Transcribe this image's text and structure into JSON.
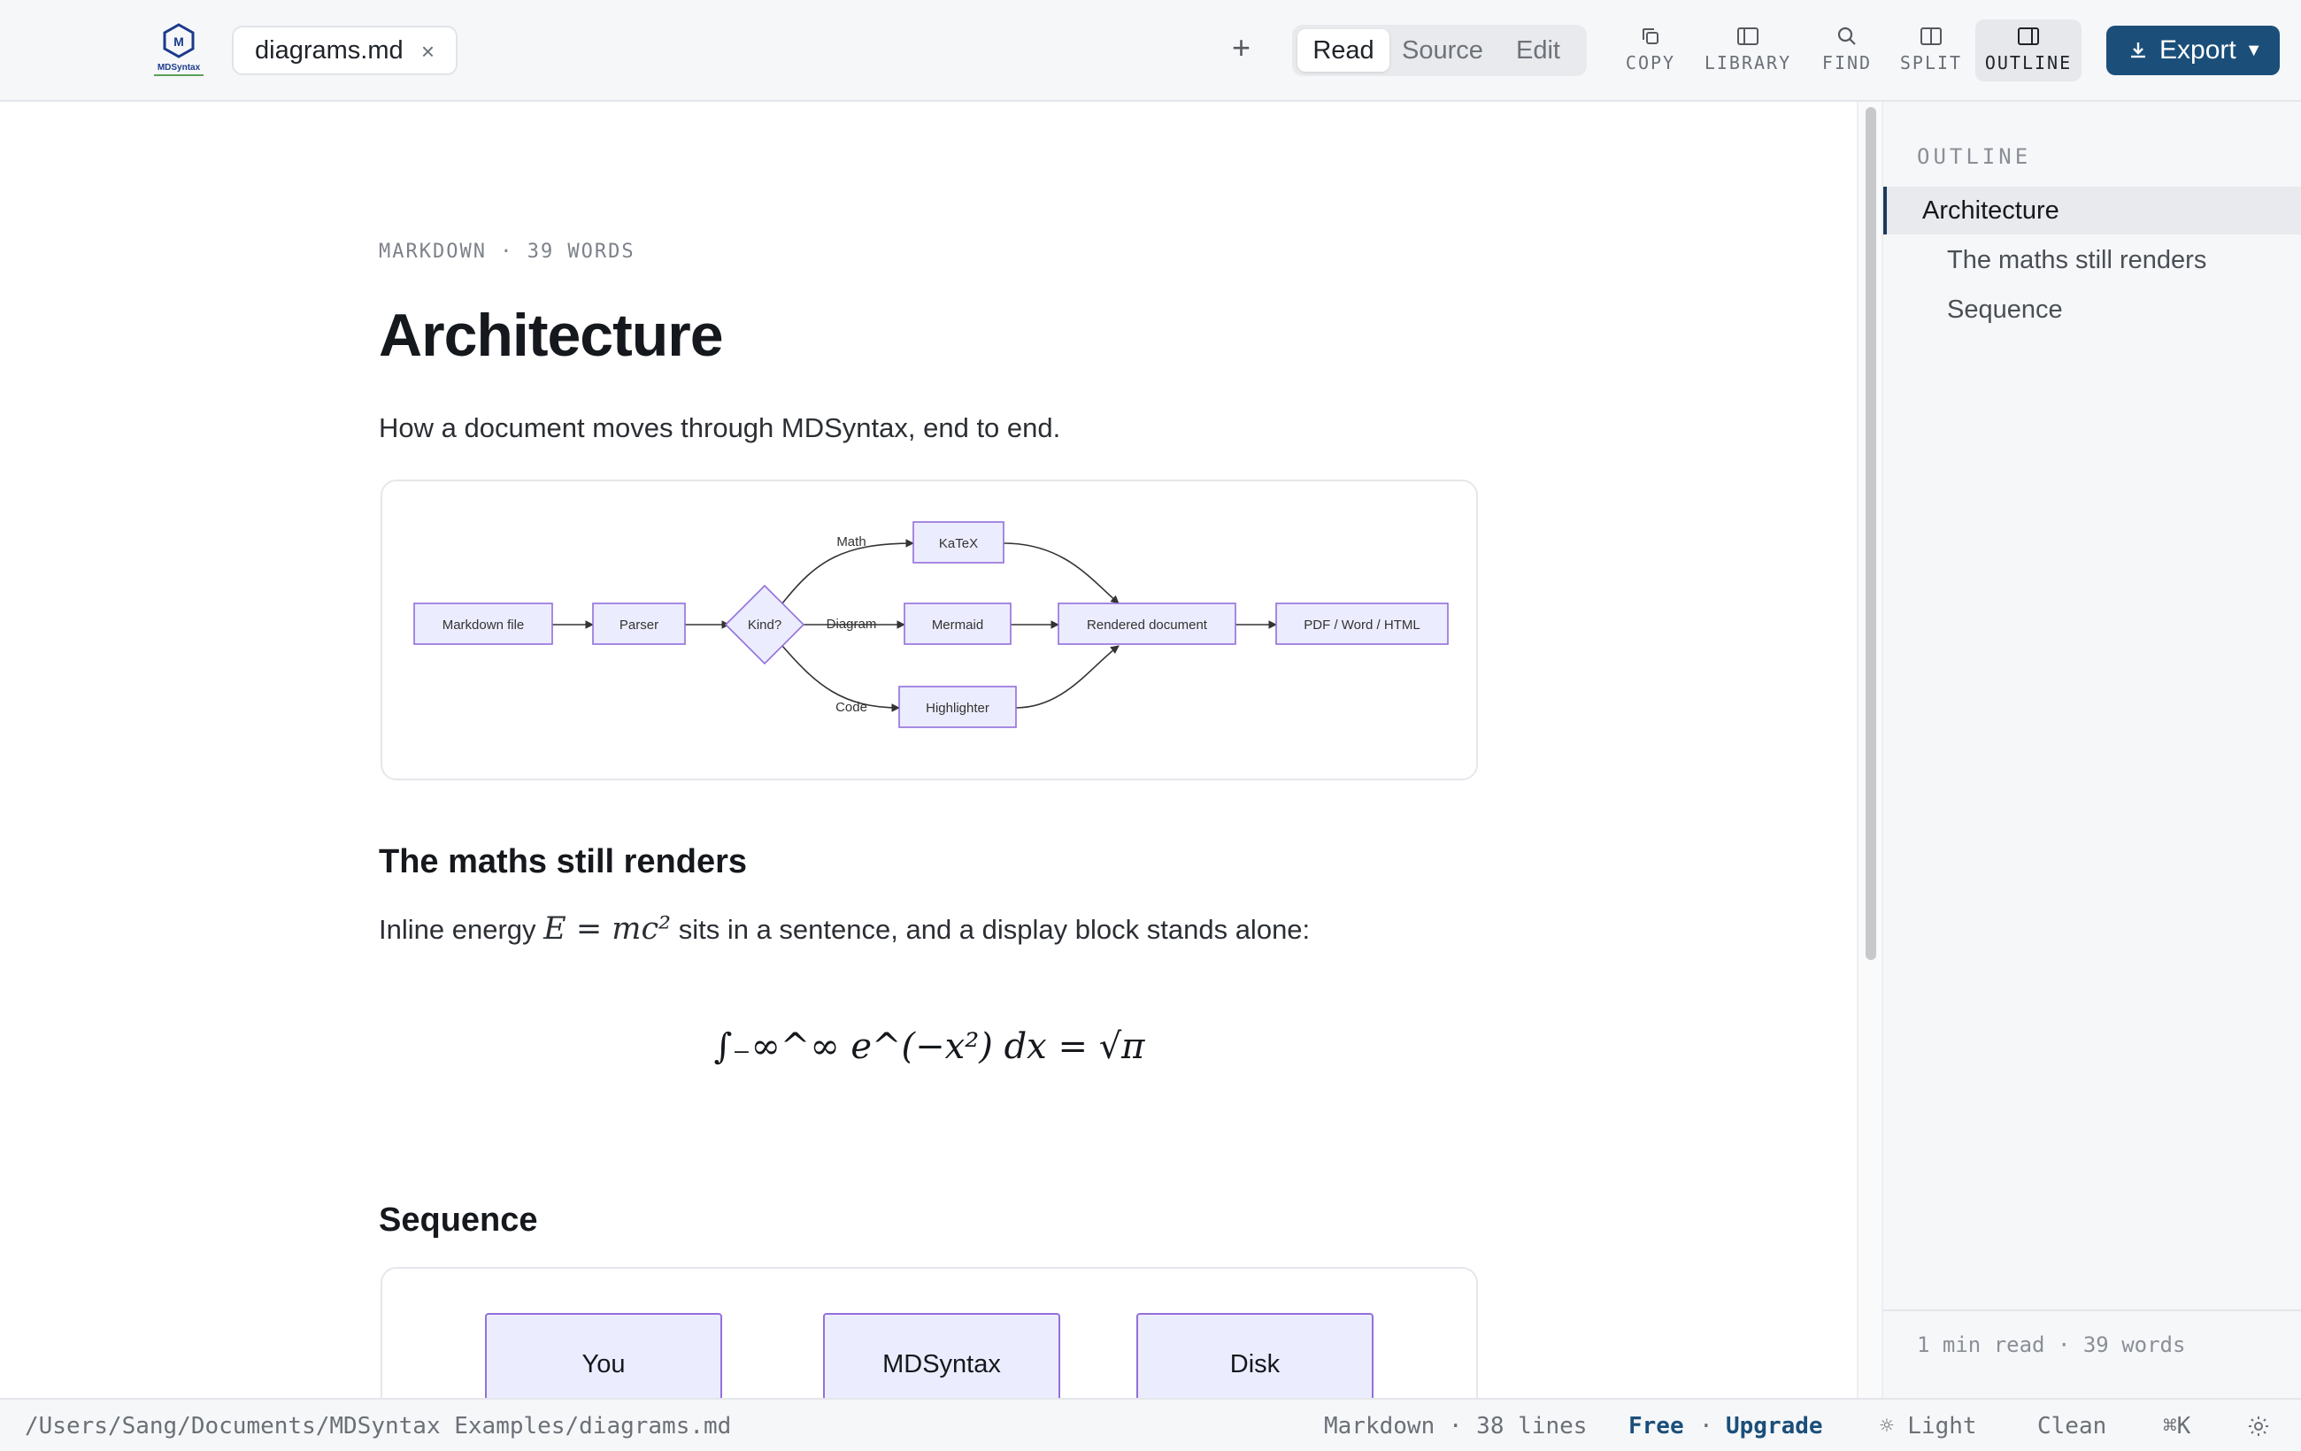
{
  "toolbar": {
    "logo_text": "MDSyntax",
    "tab": {
      "label": "diagrams.md",
      "close": "×"
    },
    "new_tab": "+",
    "view_modes": [
      "Read",
      "Source",
      "Edit"
    ],
    "active_view_mode": "Read",
    "tools": [
      {
        "label": "COPY",
        "icon": "copy-icon"
      },
      {
        "label": "LIBRARY",
        "icon": "library-icon"
      },
      {
        "label": "FIND",
        "icon": "search-icon"
      },
      {
        "label": "SPLIT",
        "icon": "split-icon"
      },
      {
        "label": "OUTLINE",
        "icon": "outline-icon",
        "active": true
      }
    ],
    "export": {
      "label": "Export",
      "icon": "download-icon"
    }
  },
  "document": {
    "meta": "MARKDOWN · 39 WORDS",
    "title": "Architecture",
    "lead": "How a document moves through MDSyntax, end to end.",
    "flowchart": {
      "nodes": {
        "markdown": "Markdown file",
        "parser": "Parser",
        "kind": "Kind?",
        "katex": "KaTeX",
        "mermaid": "Mermaid",
        "highlighter": "Highlighter",
        "rendered": "Rendered document",
        "output": "PDF / Word / HTML"
      },
      "edges": {
        "math": "Math",
        "diagram": "Diagram",
        "code": "Code"
      }
    },
    "section_math": {
      "heading": "The maths still renders",
      "text_before": "Inline energy",
      "inline_formula": "E = mc²",
      "text_after": "sits in a sentence, and a display block stands alone:",
      "display_formula": "∫₋∞^∞ e^(−x²) dx = √π"
    },
    "section_sequence": {
      "heading": "Sequence",
      "participants": [
        "You",
        "MDSyntax",
        "Disk"
      ]
    }
  },
  "outline": {
    "title": "OUTLINE",
    "items": [
      {
        "label": "Architecture",
        "level": 1,
        "active": true
      },
      {
        "label": "The maths still renders",
        "level": 2
      },
      {
        "label": "Sequence",
        "level": 2
      }
    ],
    "footer": "1 min read · 39 words"
  },
  "statusbar": {
    "path": "/Users/Sang/Documents/MDSyntax Examples/diagrams.md",
    "language": "Markdown · 38 lines",
    "plan": "Free",
    "separator": "·",
    "upgrade": "Upgrade",
    "theme": "☼ Light",
    "style": "Clean",
    "shortcut": "⌘K",
    "settings_icon": "sun-icon"
  },
  "colors": {
    "accent": "#1b4f7a",
    "node_fill": "#ececff",
    "node_stroke": "#9370db"
  }
}
